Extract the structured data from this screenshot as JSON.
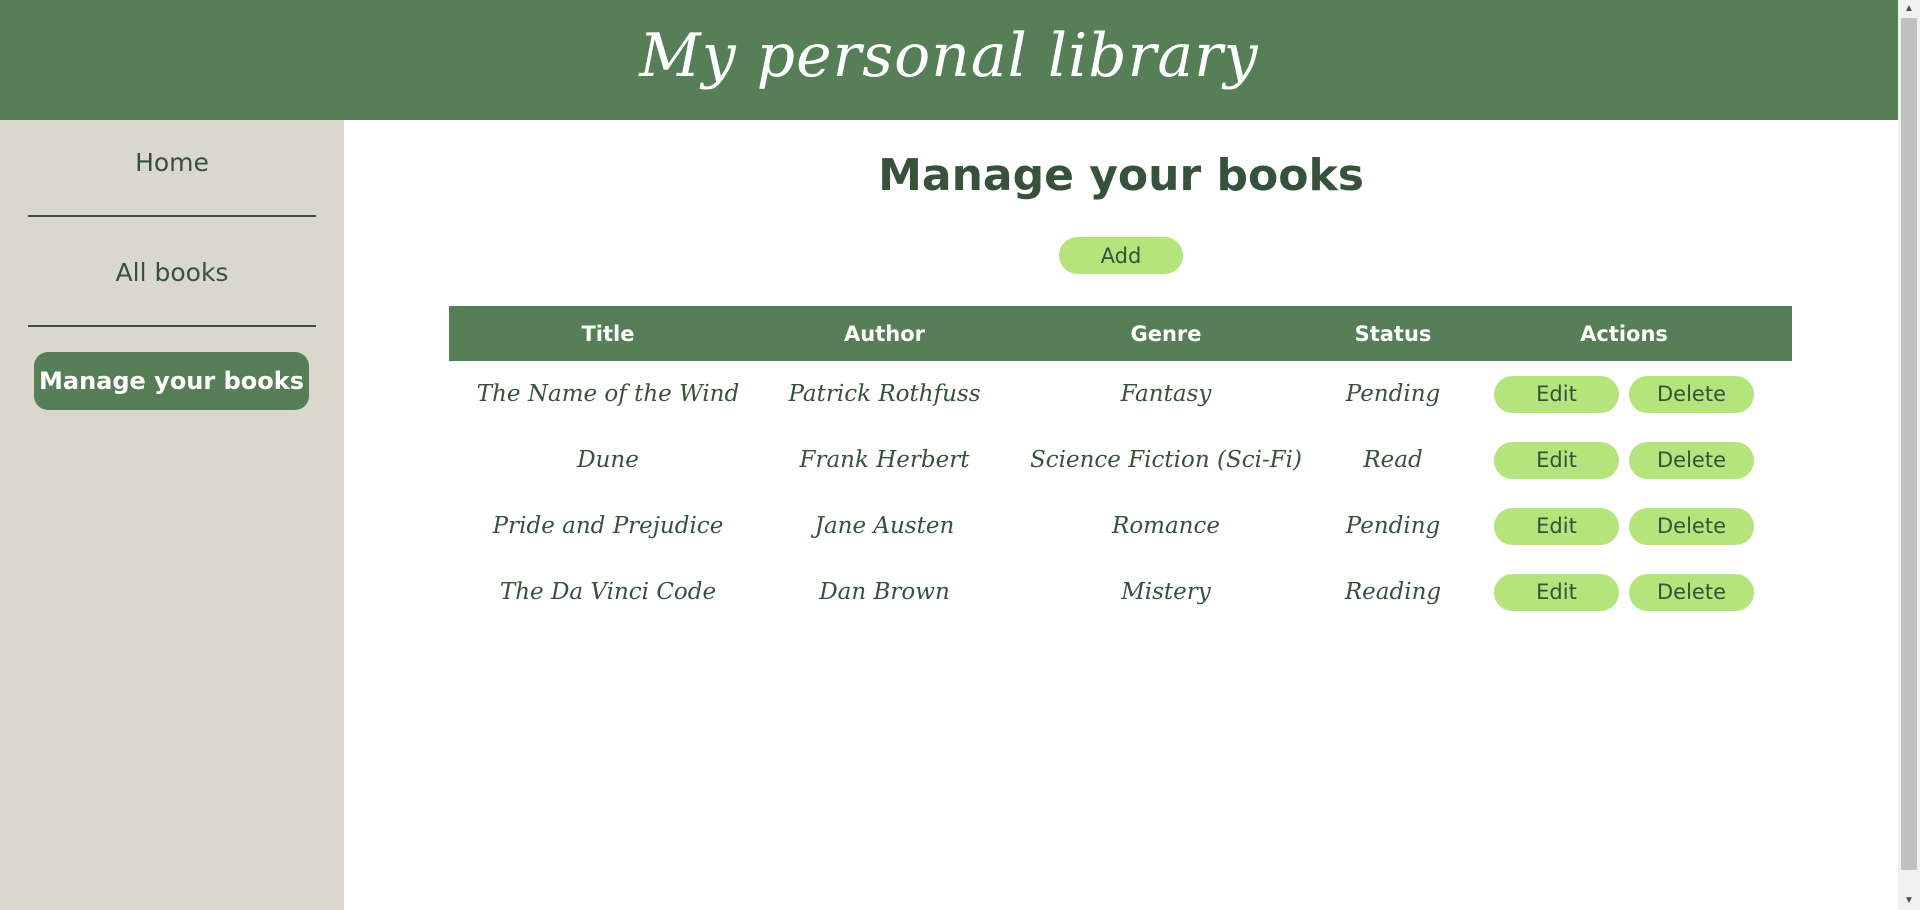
{
  "header": {
    "title": "My personal library"
  },
  "sidebar": {
    "items": [
      {
        "label": "Home"
      },
      {
        "label": "All books"
      },
      {
        "label": "Manage your books"
      }
    ]
  },
  "main": {
    "title": "Manage your books",
    "add_label": "Add",
    "table": {
      "headers": [
        "Title",
        "Author",
        "Genre",
        "Status",
        "Actions"
      ],
      "rows": [
        {
          "title": "The Name of the Wind",
          "author": "Patrick Rothfuss",
          "genre": "Fantasy",
          "status": "Pending"
        },
        {
          "title": "Dune",
          "author": "Frank Herbert",
          "genre": "Science Fiction (Sci-Fi)",
          "status": "Read"
        },
        {
          "title": "Pride and Prejudice",
          "author": "Jane Austen",
          "genre": "Romance",
          "status": "Pending"
        },
        {
          "title": "The Da Vinci Code",
          "author": "Dan Brown",
          "genre": "Mistery",
          "status": "Reading"
        }
      ],
      "edit_label": "Edit",
      "delete_label": "Delete"
    }
  },
  "colors": {
    "primary": "#567f57",
    "sidebar_bg": "#dad8cd",
    "button": "#b5e37c",
    "text_dark": "#36523a"
  },
  "icons": {
    "scroll_up": "scroll-up-arrow-icon",
    "scroll_down": "scroll-down-arrow-icon"
  }
}
